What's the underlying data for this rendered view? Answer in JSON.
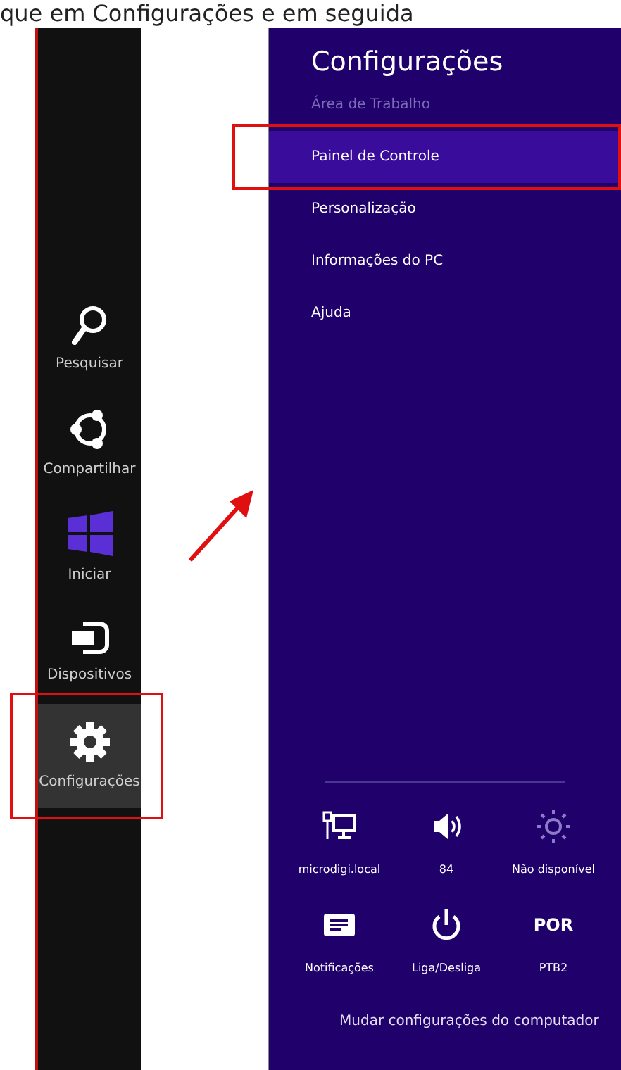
{
  "caption": "que em Configurações e em seguida",
  "charms": [
    {
      "kind": "search",
      "label": "Pesquisar",
      "selected": false,
      "outlined": false
    },
    {
      "kind": "share",
      "label": "Compartilhar",
      "selected": false,
      "outlined": false
    },
    {
      "kind": "start",
      "label": "Iniciar",
      "selected": false,
      "outlined": false
    },
    {
      "kind": "devices",
      "label": "Dispositivos",
      "selected": false,
      "outlined": false
    },
    {
      "kind": "settings",
      "label": "Configurações",
      "selected": true,
      "outlined": true
    }
  ],
  "settings_panel": {
    "title": "Configurações",
    "subtitle": "Área de Trabalho",
    "items": [
      {
        "label": "Painel de Controle",
        "selected": true,
        "outlined": true
      },
      {
        "label": "Personalização",
        "selected": false,
        "outlined": false
      },
      {
        "label": "Informações do PC",
        "selected": false,
        "outlined": false
      },
      {
        "label": "Ajuda",
        "selected": false,
        "outlined": false
      }
    ],
    "tiles": [
      {
        "kind": "network",
        "label": "microdigi.local",
        "disabled": false
      },
      {
        "kind": "volume",
        "label": "84",
        "disabled": false
      },
      {
        "kind": "brightness",
        "label": "Não disponível",
        "disabled": true
      },
      {
        "kind": "notifications",
        "label": "Notificações",
        "disabled": false
      },
      {
        "kind": "power",
        "label": "Liga/Desliga",
        "disabled": false
      },
      {
        "kind": "language",
        "icon_text": "POR",
        "label": "PTB2",
        "disabled": false
      }
    ],
    "footer_link": "Mudar configurações do computador"
  }
}
